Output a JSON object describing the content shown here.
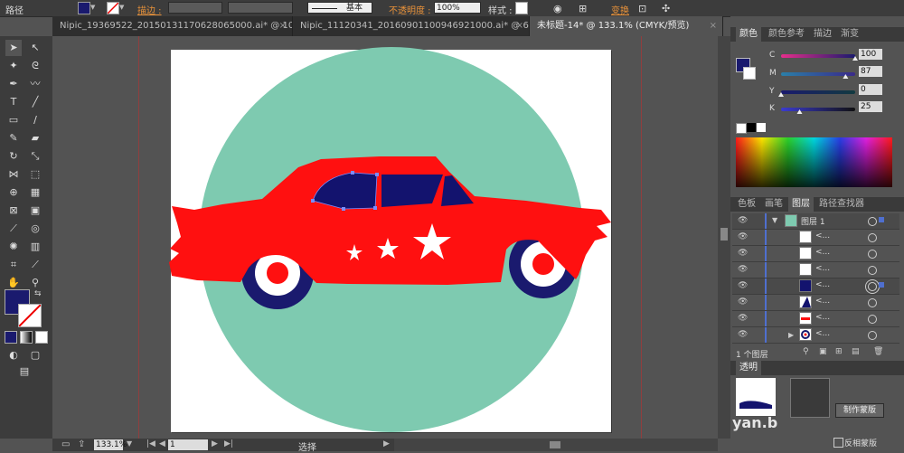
{
  "control_bar": {
    "object_label": "路径",
    "stroke_label": "描边 :",
    "stroke_style": "基本",
    "opacity_label": "不透明度 :",
    "opacity_value": "100%",
    "style_label": "样式 :",
    "transform_label": "变换",
    "fill_color": "#1a1a6e",
    "accent_color": "#e7913a"
  },
  "tabs": [
    {
      "label": "Nipic_19369522_20150131170628065000.ai* @ 10...",
      "close": "×"
    },
    {
      "label": "Nipic_11120341_20160901100946921000.ai* @ 66...",
      "close": "×"
    },
    {
      "label": "未标题-14* @ 133.1% (CMYK/预览)",
      "close": "×"
    }
  ],
  "status": {
    "zoom": "133.1%",
    "artboard": "1",
    "tool": "选择"
  },
  "color_panel": {
    "tabs": [
      "颜色",
      "颜色参考",
      "描边",
      "渐变"
    ],
    "channels": [
      {
        "name": "C",
        "value": "100",
        "level": 1.0
      },
      {
        "name": "M",
        "value": "87",
        "level": 0.87
      },
      {
        "name": "Y",
        "value": "0",
        "level": 0.0
      },
      {
        "name": "K",
        "value": "25",
        "level": 0.25
      }
    ]
  },
  "layers_panel": {
    "tabs": [
      "色板",
      "画笔",
      "图层",
      "路径查找器"
    ],
    "layer_name": "图层 1",
    "sub_items": [
      "<...",
      "<...",
      "<...",
      "<...",
      "<...",
      "<...",
      "<..."
    ],
    "footer_count": "1 个图层"
  },
  "transparency_panel": {
    "title": "透明",
    "make_mask": "制作蒙版",
    "invert_mask": "反相蒙版",
    "watermark": "yan.b"
  },
  "artwork": {
    "circle_color": "#7ecab0",
    "car_color": "#ff1010",
    "window_color": "#13136e",
    "wheel_color": "#1a1a6e"
  }
}
